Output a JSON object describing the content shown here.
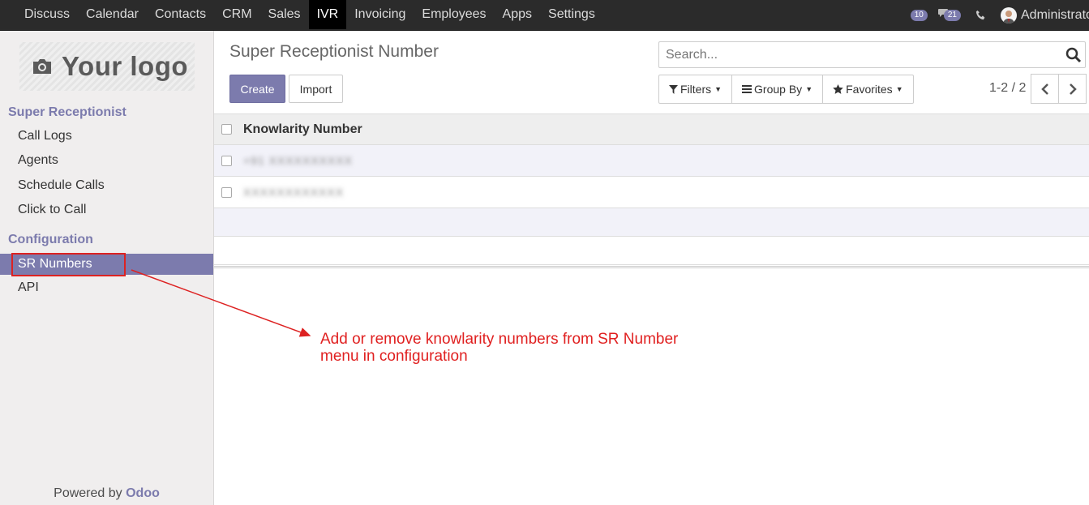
{
  "topbar": {
    "menu": [
      "Discuss",
      "Calendar",
      "Contacts",
      "CRM",
      "Sales",
      "IVR",
      "Invoicing",
      "Employees",
      "Apps",
      "Settings"
    ],
    "active_menu": "IVR",
    "activity_count": "10",
    "message_count": "21",
    "user_name": "Administrator"
  },
  "sidebar": {
    "logo_text": "Your logo",
    "sections": [
      {
        "title": "Super Receptionist",
        "items": [
          "Call Logs",
          "Agents",
          "Schedule Calls",
          "Click to Call"
        ]
      },
      {
        "title": "Configuration",
        "items": [
          "SR Numbers",
          "API"
        ]
      }
    ],
    "active_item": "SR Numbers",
    "powered_by": "Powered by",
    "powered_brand": "Odoo"
  },
  "control_panel": {
    "breadcrumb": "Super Receptionist Number",
    "create_label": "Create",
    "import_label": "Import",
    "search_placeholder": "Search...",
    "filters_label": "Filters",
    "group_by_label": "Group By",
    "favorites_label": "Favorites",
    "pager": "1-2 / 2"
  },
  "list": {
    "column": "Knowlarity Number",
    "rows": [
      "+91 XXXXXXXXXX",
      "XXXXXXXXXXXX"
    ]
  },
  "annotation": {
    "note": "Add or remove knowlarity numbers from SR Number menu in configuration",
    "note_line1": "Add or remove knowlarity numbers from SR Number",
    "note_line2": "menu in configuration",
    "color": "#e02020"
  },
  "colors": {
    "brand": "#7c7bad",
    "topbar": "#2b2b2b",
    "sidebar": "#f0eeee"
  }
}
